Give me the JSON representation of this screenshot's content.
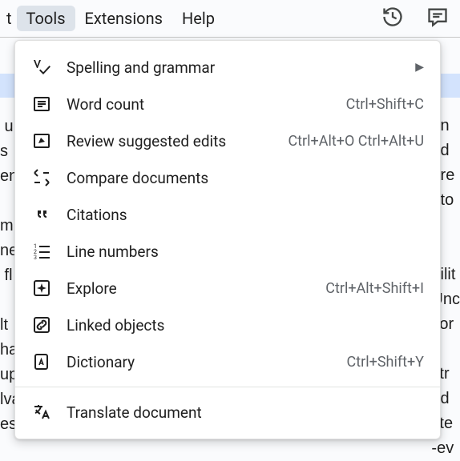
{
  "menubar": {
    "preceding_fragment": "t",
    "items": [
      {
        "label": "Tools",
        "active": true
      },
      {
        "label": "Extensions",
        "active": false
      },
      {
        "label": "Help",
        "active": false
      }
    ]
  },
  "dropdown": {
    "items": [
      {
        "label": "Spelling and grammar",
        "shortcut": "",
        "submenu": true,
        "icon": "spellcheck-icon"
      },
      {
        "label": "Word count",
        "shortcut": "Ctrl+Shift+C",
        "submenu": false,
        "icon": "word-count-icon"
      },
      {
        "label": "Review suggested edits",
        "shortcut": "Ctrl+Alt+O Ctrl+Alt+U",
        "submenu": false,
        "icon": "review-edits-icon"
      },
      {
        "label": "Compare documents",
        "shortcut": "",
        "submenu": false,
        "icon": "compare-icon"
      },
      {
        "label": "Citations",
        "shortcut": "",
        "submenu": false,
        "icon": "citations-icon"
      },
      {
        "label": "Line numbers",
        "shortcut": "",
        "submenu": false,
        "icon": "line-numbers-icon"
      },
      {
        "label": "Explore",
        "shortcut": "Ctrl+Alt+Shift+I",
        "submenu": false,
        "icon": "explore-icon"
      },
      {
        "label": "Linked objects",
        "shortcut": "",
        "submenu": false,
        "icon": "linked-objects-icon"
      },
      {
        "label": "Dictionary",
        "shortcut": "Ctrl+Shift+Y",
        "submenu": false,
        "icon": "dictionary-icon"
      },
      {
        "separator": true
      },
      {
        "label": "Translate document",
        "shortcut": "",
        "submenu": false,
        "icon": "translate-icon"
      }
    ]
  },
  "background_doc": {
    "left_fragments": "\n u\ns\nen\n\nm\nne\n fl\n\nlt\nha\nup\nlva\nes",
    "right_fragments": "an\nod\nere\nuto\n\n\nbilit\nUnc\nvor\n\nstr\nad\nitte\n-ev"
  }
}
